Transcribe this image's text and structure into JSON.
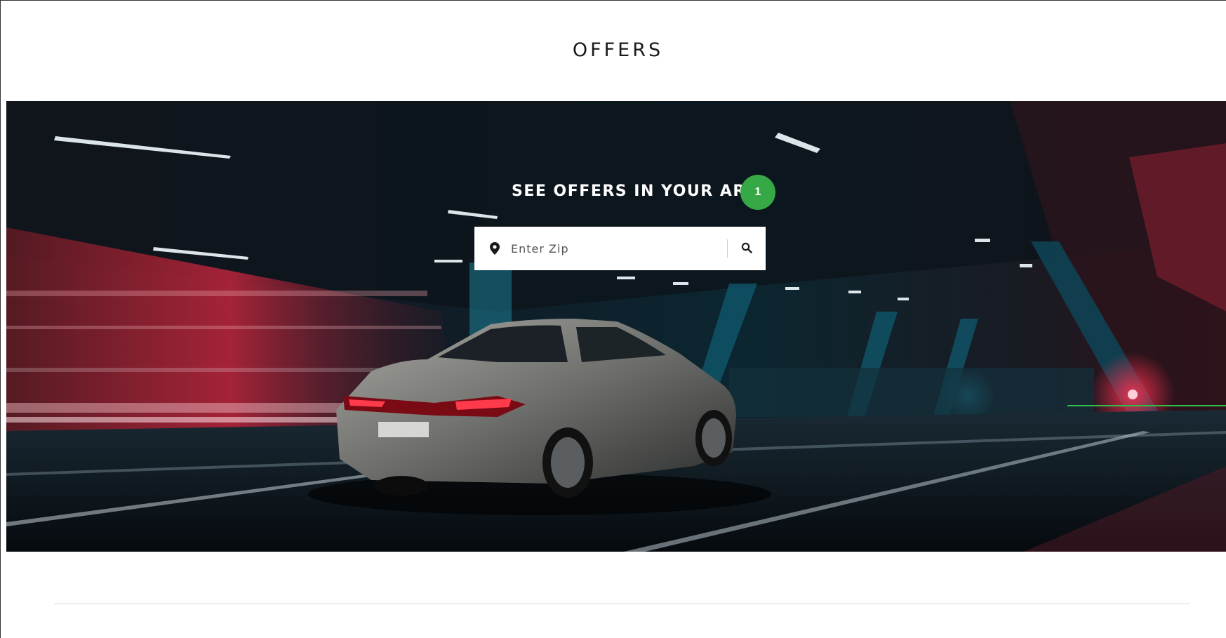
{
  "page": {
    "title": "OFFERS"
  },
  "hero": {
    "heading": "SEE OFFERS IN YOUR AREA",
    "step_badge": "1",
    "zip_search": {
      "placeholder": "Enter Zip",
      "value": "",
      "location_icon": "map-pin-icon",
      "search_icon": "magnifier-icon"
    },
    "image_description_icon": "car-hero-image"
  },
  "colors": {
    "badge": "#36a845",
    "title_text": "#1a1a1a",
    "hero_text": "#ffffff",
    "callout_line": "#2fbf4a"
  }
}
